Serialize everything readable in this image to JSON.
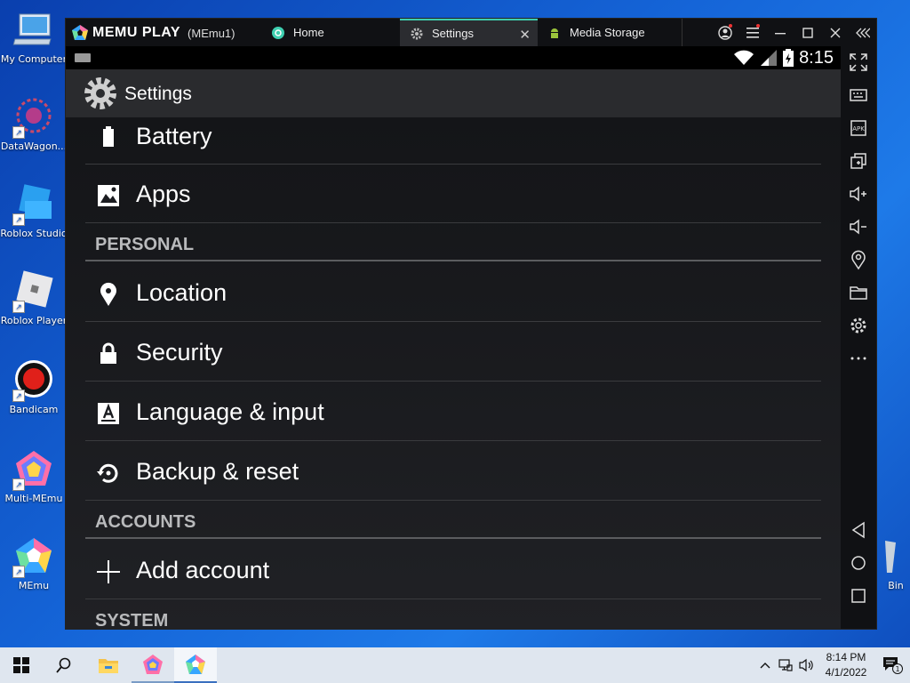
{
  "desktop": {
    "icons": [
      {
        "label": "My Computer"
      },
      {
        "label": "DataWagon..."
      },
      {
        "label": "Roblox Studio"
      },
      {
        "label": "Roblox Player"
      },
      {
        "label": "Bandicam"
      },
      {
        "label": "Multi-MEmu"
      },
      {
        "label": "MEmu"
      },
      {
        "label": "Bin"
      }
    ]
  },
  "emulator": {
    "brand": "MEMU PLAY",
    "instance": "(MEmu1)",
    "tabs": [
      {
        "label": "Home"
      },
      {
        "label": "Settings"
      },
      {
        "label": "Media Storage"
      }
    ],
    "close_tab": "✕"
  },
  "android": {
    "status": {
      "time": "8:15"
    },
    "action_bar_title": "Settings",
    "rows": [
      {
        "label": "Battery"
      },
      {
        "label": "Apps"
      },
      {
        "label": "Location"
      },
      {
        "label": "Security"
      },
      {
        "label": "Language & input"
      },
      {
        "label": "Backup & reset"
      },
      {
        "label": "Add account"
      }
    ],
    "headers": {
      "personal": "PERSONAL",
      "accounts": "ACCOUNTS",
      "system": "SYSTEM"
    }
  },
  "taskbar": {
    "time": "8:14 PM",
    "date": "4/1/2022",
    "notification_count": "1"
  },
  "colors": {
    "accent": "#3ecfb0",
    "android_bg": "#1b1c20",
    "desktop": "#1565d8"
  }
}
